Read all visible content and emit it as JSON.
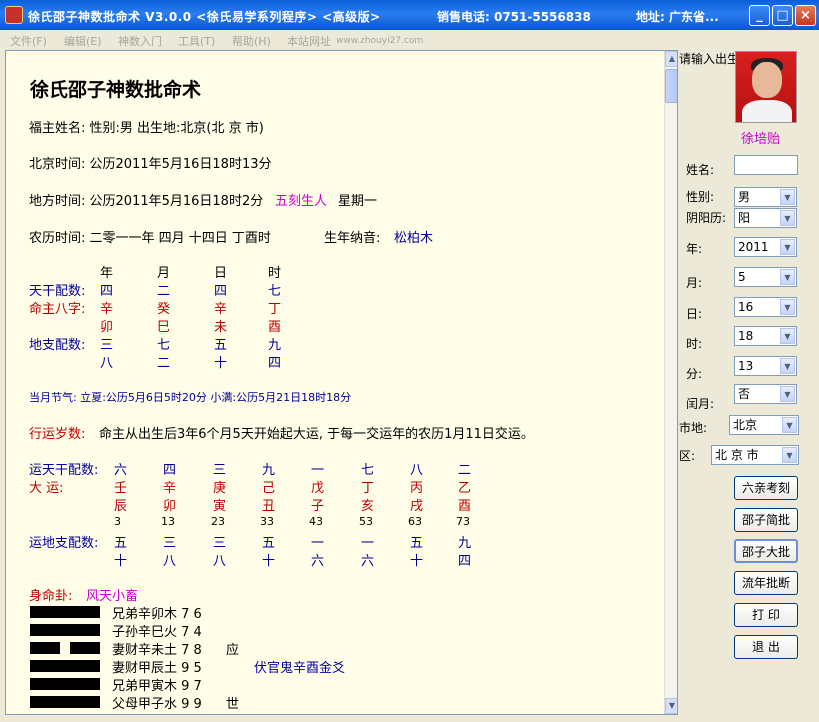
{
  "window": {
    "title": "徐氏邵子神数批命术 V3.0.0 <徐氏易学系列程序> <高级版>",
    "phone": "销售电话: 0751-5556838",
    "address": "地址: 广东省...",
    "controls": {
      "minimize": "_",
      "maximize": "□",
      "close": "×"
    }
  },
  "menu": {
    "items": [
      "文件(F)",
      "编辑(E)",
      "神数入门",
      "工具(T)",
      "帮助(H)",
      "本站网址"
    ],
    "url": "www.zhouyi27.com"
  },
  "content": {
    "heading": "徐氏邵子神数批命术",
    "subject_line": "福主姓名:  性别:男  出生地:北京(北 京 市)",
    "beijing_time": "北京时间: 公历2011年5月16日18时13分",
    "local_time_prefix": "地方时间: 公历2011年5月16日18时2分",
    "local_time_birth": "五刻生人",
    "local_time_weekday": "星期一",
    "lunar_prefix": "农历时间: 二零一一年 四月 十四日 丁酉时",
    "nayin_label": "生年纳音:",
    "nayin_value": "松柏木",
    "pillar_headers": [
      "年",
      "月",
      "日",
      "时"
    ],
    "tiangan_label": "天干配数:",
    "tiangan_nums": [
      "四",
      "二",
      "四",
      "七"
    ],
    "bazi_label": "命主八字:",
    "bazi_stems": [
      "辛",
      "癸",
      "辛",
      "丁"
    ],
    "bazi_branches": [
      "卯",
      "巳",
      "未",
      "酉"
    ],
    "dizhi_label": "地支配数:",
    "dizhi_nums_1": [
      "三",
      "七",
      "五",
      "九"
    ],
    "dizhi_nums_2": [
      "八",
      "二",
      "十",
      "四"
    ],
    "jieqi": "当月节气: 立夏:公历5月6日5时20分 小满:公历5月21日18时18分",
    "qiyun_label": "行运岁数:",
    "qiyun_text": "命主从出生后3年6个月5天开始起大运, 于每一交运年的农历1月11日交运。",
    "yun_tian_label": "运天干配数:",
    "yun_tian_nums": [
      "六",
      "四",
      "三",
      "九",
      "一",
      "七",
      "八",
      "二"
    ],
    "dayun_label": "大    运:",
    "dayun_stems": [
      "壬",
      "辛",
      "庚",
      "己",
      "戊",
      "丁",
      "丙",
      "乙"
    ],
    "dayun_branches": [
      "辰",
      "卯",
      "寅",
      "丑",
      "子",
      "亥",
      "戌",
      "酉"
    ],
    "dayun_ages": [
      "3",
      "13",
      "23",
      "33",
      "43",
      "53",
      "63",
      "73"
    ],
    "yun_di_label": "运地支配数:",
    "yun_di_nums_1": [
      "五",
      "三",
      "三",
      "五",
      "一",
      "一",
      "五",
      "九"
    ],
    "yun_di_nums_2": [
      "十",
      "八",
      "八",
      "十",
      "六",
      "六",
      "十",
      "四"
    ],
    "gua_label": "身命卦:",
    "gua_name": "风天小畜",
    "lines": [
      {
        "text": "兄弟辛卯木 7 6",
        "mark": "",
        "yin": false
      },
      {
        "text": "子孙辛巳火 7 4",
        "mark": "",
        "yin": false
      },
      {
        "text": "妻财辛未土 7 8",
        "mark": "应",
        "yin": true
      },
      {
        "text": "妻财甲辰土 9 5",
        "mark": "",
        "yin": false
      },
      {
        "text": "兄弟甲寅木 9 7",
        "mark": "",
        "yin": false
      },
      {
        "text": "父母甲子水 9 9",
        "mark": "世",
        "yin": false
      }
    ],
    "fushen": "伏官鬼辛酉金爻"
  },
  "side": {
    "prompt": "请输入出生",
    "photo_name": "徐培贻",
    "name_label": "姓名:",
    "name_value": "",
    "gender_label": "性别:",
    "gender_value": "男",
    "calendar_label": "阴阳历:",
    "calendar_value": "阳",
    "year_label": "年:",
    "year_value": "2011",
    "month_label": "月:",
    "month_value": "5",
    "day_label": "日:",
    "day_value": "16",
    "hour_label": "时:",
    "hour_value": "18",
    "minute_label": "分:",
    "minute_value": "13",
    "leap_label": "闰月:",
    "leap_value": "否",
    "province_label": "市地:",
    "province_value": "北京",
    "district_label": "区:",
    "district_value": "北 京 市",
    "buttons": [
      "六亲考刻",
      "邵子简批",
      "邵子大批",
      "流年批断",
      "打 印",
      "退 出"
    ]
  }
}
